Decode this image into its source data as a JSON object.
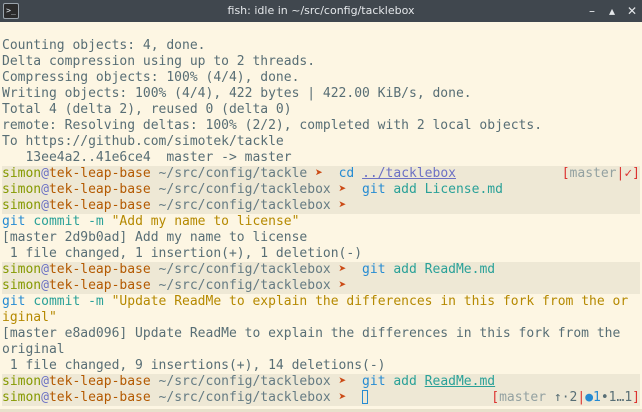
{
  "window": {
    "title": "fish: idle in ~/src/config/tacklebox",
    "icon": "terminal-icon",
    "buttons": {
      "minimize": "–",
      "maximize": "▴",
      "close": "✕"
    }
  },
  "colors": {
    "background": "#fdf6e3",
    "prompt_band": "#eee8d5",
    "user": "#859900",
    "host": "#b35900",
    "arrow": "#cb4b16",
    "command": "#268bd2",
    "argument": "#2aa198",
    "string": "#b58900"
  },
  "output_top": [
    "Counting objects: 4, done.",
    "Delta compression using up to 2 threads.",
    "Compressing objects: 100% (4/4), done.",
    "Writing objects: 100% (4/4), 422 bytes | 422.00 KiB/s, done.",
    "Total 4 (delta 2), reused 0 (delta 0)",
    "remote: Resolving deltas: 100% (2/2), completed with 2 local objects.",
    "To https://github.com/simotek/tackle",
    "   13ee4a2..41e6ce4  master -> master"
  ],
  "prompt": {
    "user": "simon",
    "at": "@",
    "host": "tek-leap-base",
    "arrow": "➤"
  },
  "p1": {
    "cwd": "~/src/config/tackle",
    "cmd": "cd",
    "arg": "../tacklebox",
    "status": {
      "open": "[",
      "branch": "master",
      "sep": "|",
      "mark": "✓",
      "close": "]"
    }
  },
  "p2": {
    "cwd": "~/src/config/tacklebox",
    "cmd": "git",
    "arg": "add License.md"
  },
  "p3": {
    "cwd": "~/src/config/tacklebox",
    "cmd": "git",
    "arg": "commit -m",
    "str": "\"Add my name to license\""
  },
  "out3": [
    "[master 2d9b0ad] Add my name to license",
    " 1 file changed, 1 insertion(+), 1 deletion(-)"
  ],
  "p4": {
    "cwd": "~/src/config/tacklebox",
    "cmd": "git",
    "arg": "add ReadMe.md"
  },
  "p5": {
    "cwd": "~/src/config/tacklebox",
    "cmd": "git",
    "arg": "commit -m",
    "str1": "\"Update ReadMe to explain the differences in this fork from the or",
    "str2": "iginal\""
  },
  "out5": [
    "[master e8ad096] Update ReadMe to explain the differences in this fork from the",
    "original",
    " 1 file changed, 9 insertions(+), 14 deletions(-)"
  ],
  "p6": {
    "cwd": "~/src/config/tacklebox",
    "cmd": "git",
    "arg1": "add",
    "arg2": "ReadMe.md"
  },
  "p7": {
    "cwd": "~/src/config/tacklebox",
    "status": {
      "open": "[",
      "branch": "master",
      "ahead": "↑·2",
      "sep1": "|",
      "staged": "●1",
      "stagedplus": "•1",
      "dots": "…1",
      "sep2": "|",
      "close": "]"
    }
  }
}
